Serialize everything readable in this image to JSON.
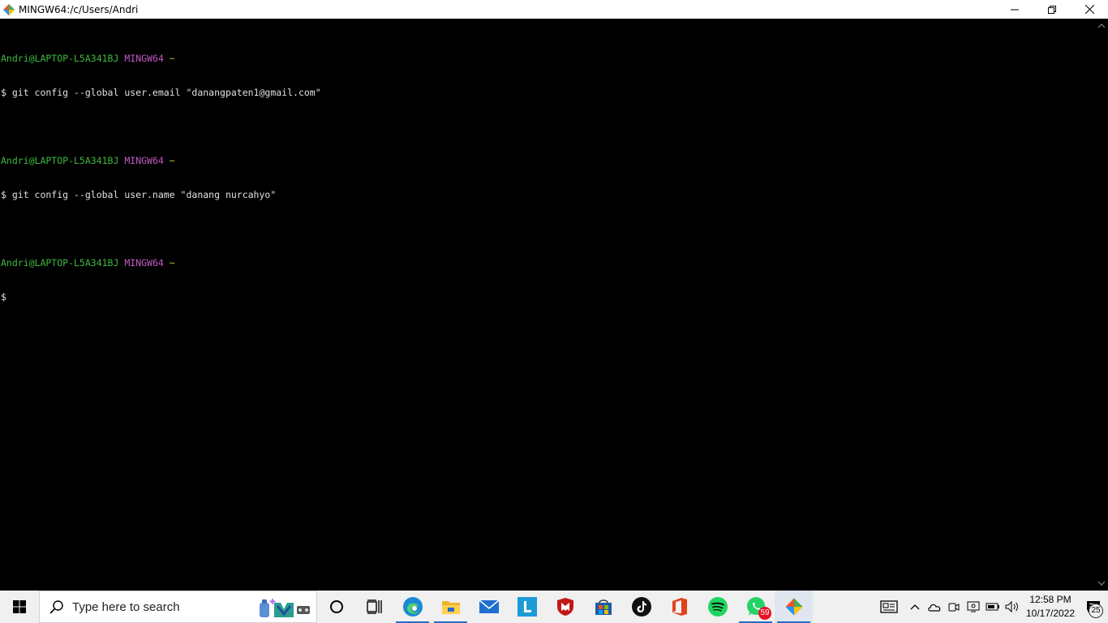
{
  "window": {
    "title": "MINGW64:/c/Users/Andri"
  },
  "terminal": {
    "blocks": [
      {
        "user": "Andri@LAPTOP-L5A341BJ",
        "system": "MINGW64",
        "path": "~",
        "command": "$ git config --global user.email \"danangpaten1@gmail.com\""
      },
      {
        "user": "Andri@LAPTOP-L5A341BJ",
        "system": "MINGW64",
        "path": "~",
        "command": "$ git config --global user.name \"danang nurcahyo\""
      },
      {
        "user": "Andri@LAPTOP-L5A341BJ",
        "system": "MINGW64",
        "path": "~",
        "command": "$"
      }
    ]
  },
  "taskbar": {
    "search_placeholder": "Type here to search",
    "whatsapp_badge": "59",
    "clock_time": "12:58 PM",
    "clock_date": "10/17/2022",
    "notification_count": "25"
  },
  "colors": {
    "user": "#3fb83f",
    "system": "#c05ac0",
    "path": "#c8c83c",
    "accent": "#2b6cc4"
  }
}
